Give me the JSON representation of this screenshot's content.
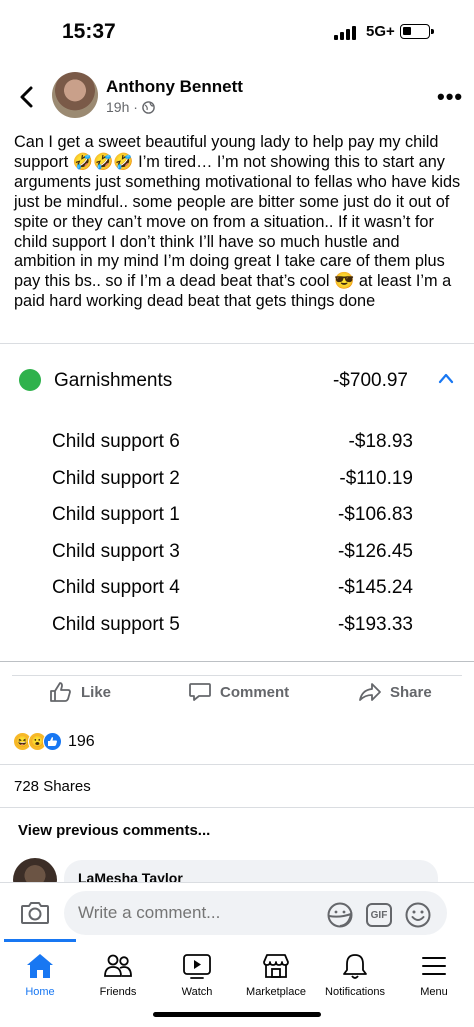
{
  "status_bar": {
    "time": "15:37",
    "network": "5G+"
  },
  "post": {
    "author": "Anthony Bennett",
    "time_ago": "19h ·",
    "text": "Can I get a sweet beautiful young lady to help pay my child support 🤣🤣🤣 I’m tired… I’m not showing this to start any arguments just something motivational to fellas who have kids just be mindful.. some people are bitter some just do it out of spite or they can’t move on from a situation.. If it wasn’t for child support I don’t think I’ll have so much hustle and ambition in my mind I’m doing great I take care of them plus pay this bs.. so if I’m a dead beat that’s cool 😎 at least I’m a paid hard working dead beat that gets things done"
  },
  "garnishments": {
    "title": "Garnishments",
    "total": "-$700.97",
    "items": [
      {
        "label": "Child support 6",
        "amount": "-$18.93"
      },
      {
        "label": "Child support 2",
        "amount": "-$110.19"
      },
      {
        "label": "Child support 1",
        "amount": "-$106.83"
      },
      {
        "label": "Child support 3",
        "amount": "-$126.45"
      },
      {
        "label": "Child support 4",
        "amount": "-$145.24"
      },
      {
        "label": "Child support 5",
        "amount": "-$193.33"
      }
    ]
  },
  "actions": {
    "like": "Like",
    "comment": "Comment",
    "share": "Share"
  },
  "reactions": {
    "count": "196"
  },
  "shares": "728 Shares",
  "comments": {
    "view_previous": "View previous comments...",
    "first_commenter": "LaMesha Taylor"
  },
  "composer": {
    "placeholder": "Write a comment...",
    "gif_label": "GIF"
  },
  "tabbar": {
    "home": "Home",
    "friends": "Friends",
    "watch": "Watch",
    "marketplace": "Marketplace",
    "notifications": "Notifications",
    "menu": "Menu"
  },
  "colors": {
    "accent": "#1877f2",
    "garnish_dot": "#2fb24c",
    "secondary_text": "#65676b"
  }
}
